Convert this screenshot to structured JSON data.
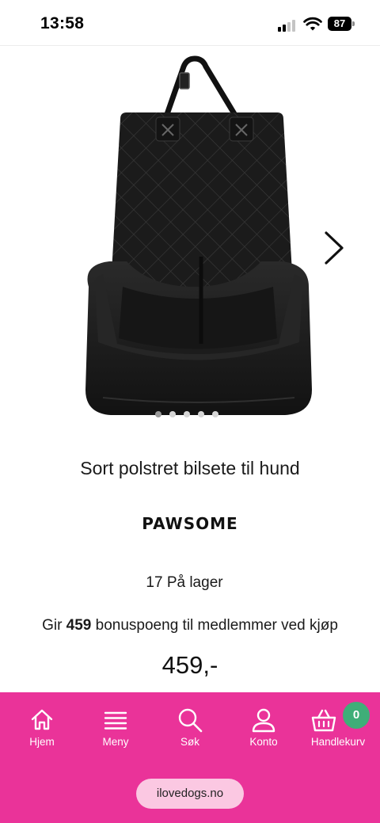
{
  "status_bar": {
    "time": "13:58",
    "battery": "87",
    "icons": [
      "signal-icon",
      "wifi-icon",
      "battery-icon"
    ]
  },
  "product": {
    "title": "Sort polstret bilsete til hund",
    "brand": "PAWSOME",
    "stock": "17 På lager",
    "bonus_prefix": "Gir ",
    "bonus_points": "459",
    "bonus_suffix": " bonuspoeng til medlemmer ved kjøp",
    "price": "459,-",
    "image_icon": "dog-car-seat-image",
    "carousel": {
      "total_slides": 5,
      "active_slide": 1
    }
  },
  "bottom_nav": {
    "items": [
      {
        "label": "Hjem",
        "icon": "home-icon"
      },
      {
        "label": "Meny",
        "icon": "menu-icon"
      },
      {
        "label": "Søk",
        "icon": "search-icon"
      },
      {
        "label": "Konto",
        "icon": "user-icon"
      },
      {
        "label": "Handlekurv",
        "icon": "basket-icon"
      }
    ],
    "cart_count": "0"
  },
  "browser": {
    "domain": "ilovedogs.no"
  },
  "colors": {
    "nav_background": "#ea3399",
    "cart_badge": "#3fae78",
    "domain_pill": "#fbc8e2"
  }
}
